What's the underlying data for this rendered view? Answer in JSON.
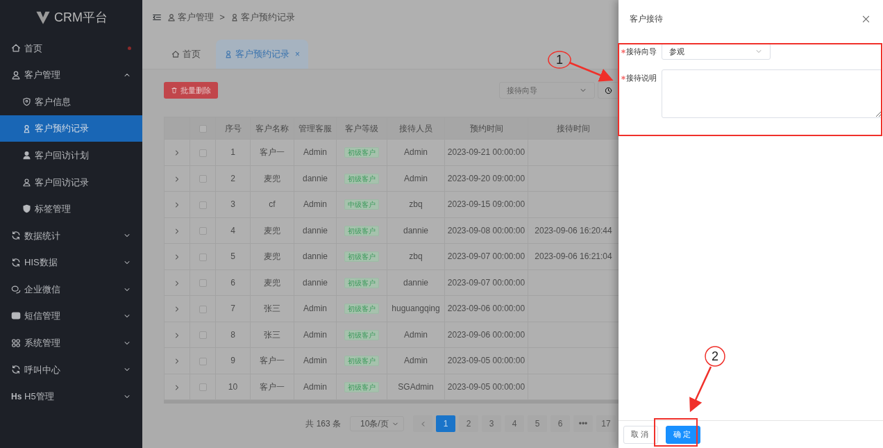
{
  "sidebar": {
    "logo": "CRM平台",
    "items": [
      {
        "label": "首页",
        "dot": true
      },
      {
        "label": "客户管理",
        "expanded": true,
        "children": [
          {
            "label": "客户信息",
            "selected": false
          },
          {
            "label": "客户预约记录",
            "selected": true
          },
          {
            "label": "客户回访计划",
            "selected": false
          },
          {
            "label": "客户回访记录",
            "selected": false
          },
          {
            "label": "标签管理",
            "selected": false
          }
        ]
      },
      {
        "label": "数据统计",
        "expanded": false
      },
      {
        "label": "HIS数据",
        "expanded": false
      },
      {
        "label": "企业微信",
        "expanded": false
      },
      {
        "label": "短信管理",
        "expanded": false
      },
      {
        "label": "系统管理",
        "expanded": false
      },
      {
        "label": "呼叫中心",
        "expanded": false
      },
      {
        "label": "H5管理",
        "expanded": false,
        "icon_text": "Hs"
      }
    ]
  },
  "header": {
    "breadcrumb": [
      "客户管理",
      "客户预约记录"
    ],
    "separator": ">"
  },
  "tabs": [
    {
      "label": "首页",
      "selected": false
    },
    {
      "label": "客户预约记录",
      "selected": true,
      "close": "×"
    }
  ],
  "toolbar": {
    "delete_button": "批量删除",
    "guide_filter": {
      "placeholder": "接待向导"
    }
  },
  "table": {
    "header_checked": false,
    "columns": [
      "序号",
      "客户名称",
      "管理客服",
      "客户等级",
      "接待人员",
      "预约时间",
      "接待时间"
    ],
    "rows": [
      {
        "expanded": false,
        "checked": false,
        "no": "1",
        "name": "客户一",
        "manager": "Admin",
        "level": "初级客户",
        "receptionist": "Admin",
        "appointment_time": "2023-09-21 00:00:00"
      },
      {
        "expanded": false,
        "checked": false,
        "no": "2",
        "name": "麦兜",
        "manager": "dannie",
        "level": "初级客户",
        "receptionist": "Admin",
        "appointment_time": "2023-09-20 09:00:00"
      },
      {
        "expanded": false,
        "checked": false,
        "no": "3",
        "name": "cf",
        "manager": "Admin",
        "level": "中级客户",
        "receptionist": "zbq",
        "appointment_time": "2023-09-15 09:00:00"
      },
      {
        "expanded": false,
        "checked": false,
        "no": "4",
        "name": "麦兜",
        "manager": "dannie",
        "level": "初级客户",
        "receptionist": "dannie",
        "appointment_time": "2023-09-08 00:00:00",
        "reception_time": "2023-09-06 16:20:44"
      },
      {
        "expanded": false,
        "checked": false,
        "no": "5",
        "name": "麦兜",
        "manager": "dannie",
        "level": "初级客户",
        "receptionist": "zbq",
        "appointment_time": "2023-09-07 00:00:00",
        "reception_time": "2023-09-06 16:21:04"
      },
      {
        "expanded": false,
        "checked": false,
        "no": "6",
        "name": "麦兜",
        "manager": "dannie",
        "level": "初级客户",
        "receptionist": "dannie",
        "appointment_time": "2023-09-07 00:00:00"
      },
      {
        "expanded": false,
        "checked": false,
        "no": "7",
        "name": "张三",
        "manager": "Admin",
        "level": "初级客户",
        "receptionist": "huguangqing",
        "appointment_time": "2023-09-06 00:00:00"
      },
      {
        "expanded": false,
        "checked": false,
        "no": "8",
        "name": "张三",
        "manager": "Admin",
        "level": "初级客户",
        "receptionist": "Admin",
        "appointment_time": "2023-09-06 00:00:00"
      },
      {
        "expanded": false,
        "checked": false,
        "no": "9",
        "name": "客户一",
        "manager": "Admin",
        "level": "初级客户",
        "receptionist": "Admin",
        "appointment_time": "2023-09-05 00:00:00"
      },
      {
        "expanded": false,
        "checked": false,
        "no": "10",
        "name": "客户一",
        "manager": "Admin",
        "level": "初级客户",
        "receptionist": "SGAdmin",
        "appointment_time": "2023-09-05 00:00:00"
      }
    ]
  },
  "pagination": {
    "total": "共 163 条",
    "page_size": "10条/页",
    "pages": [
      {
        "label": "1",
        "selected": true
      },
      {
        "label": "2",
        "selected": false
      },
      {
        "label": "3",
        "selected": false
      },
      {
        "label": "4",
        "selected": false
      },
      {
        "label": "5",
        "selected": false
      },
      {
        "label": "6",
        "selected": false
      },
      {
        "label": "•••",
        "selected": false
      },
      {
        "label": "17",
        "selected": false
      }
    ]
  },
  "drawer": {
    "title": "客户接待",
    "fields": [
      {
        "kind": "select",
        "label": "接待向导",
        "required": true,
        "value": "参观"
      },
      {
        "kind": "textarea",
        "label": "接待说明",
        "required": true
      }
    ],
    "buttons": [
      {
        "label": "取消",
        "kind": "default"
      },
      {
        "label": "确定",
        "kind": "primary"
      }
    ]
  },
  "annotations": [
    {
      "label": "1"
    },
    {
      "label": "2"
    }
  ]
}
